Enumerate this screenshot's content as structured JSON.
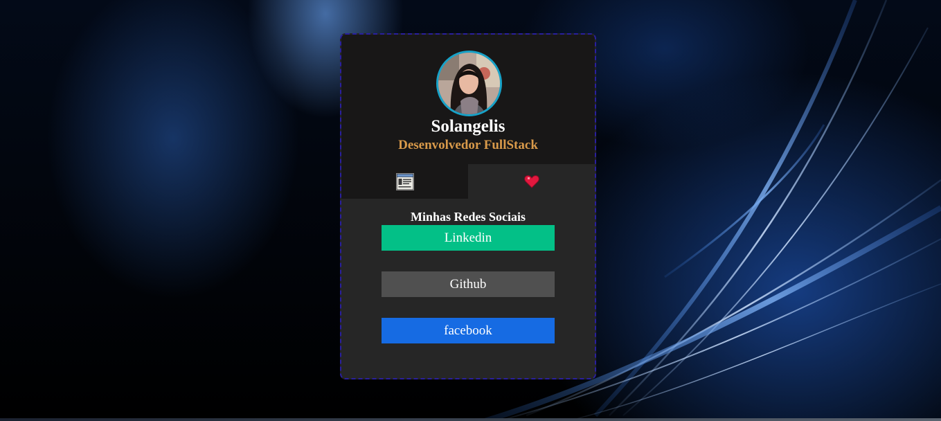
{
  "profile": {
    "name": "Solangelis",
    "role": "Desenvolvedor FullStack",
    "avatar_icon": "profile-photo"
  },
  "tabs": [
    {
      "icon": "about-card-icon"
    },
    {
      "icon": "heart-icon"
    }
  ],
  "social": {
    "title": "Minhas Redes Sociais",
    "links": [
      {
        "label": "Linkedin",
        "color": "#03c087"
      },
      {
        "label": "Github",
        "color": "#505050"
      },
      {
        "label": "facebook",
        "color": "#166be3"
      }
    ]
  },
  "colors": {
    "card_border": "#2a1f9e",
    "avatar_ring": "#17a2c8",
    "role_text": "#d99a4a",
    "card_background": "#262626",
    "header_background": "#181717"
  }
}
